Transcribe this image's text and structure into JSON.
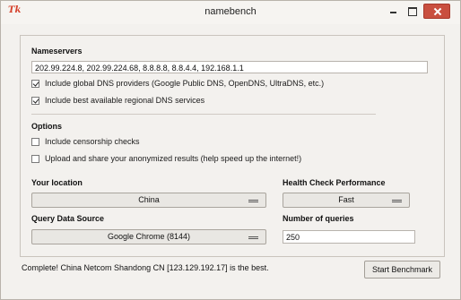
{
  "window": {
    "title": "namebench",
    "app_icon_text": "Tk"
  },
  "nameservers": {
    "heading": "Nameservers",
    "value": "202.99.224.8, 202.99.224.68, 8.8.8.8, 8.8.4.4, 192.168.1.1",
    "include_global": {
      "label": "Include global DNS providers (Google Public DNS, OpenDNS, UltraDNS, etc.)",
      "checked": true
    },
    "include_regional": {
      "label": "Include best available regional DNS services",
      "checked": true
    }
  },
  "options": {
    "heading": "Options",
    "censorship": {
      "label": "Include censorship checks",
      "checked": false
    },
    "upload": {
      "label": "Upload and share your anonymized results (help speed up the internet!)",
      "checked": false
    }
  },
  "location": {
    "heading": "Your location",
    "value": "China"
  },
  "health": {
    "heading": "Health Check Performance",
    "value": "Fast"
  },
  "query_source": {
    "heading": "Query Data Source",
    "value": "Google Chrome (8144)"
  },
  "queries": {
    "heading": "Number of queries",
    "value": "250"
  },
  "status_text": "Complete! China Netcom Shandong CN [123.129.192.17] is the best.",
  "start_button": "Start Benchmark"
}
